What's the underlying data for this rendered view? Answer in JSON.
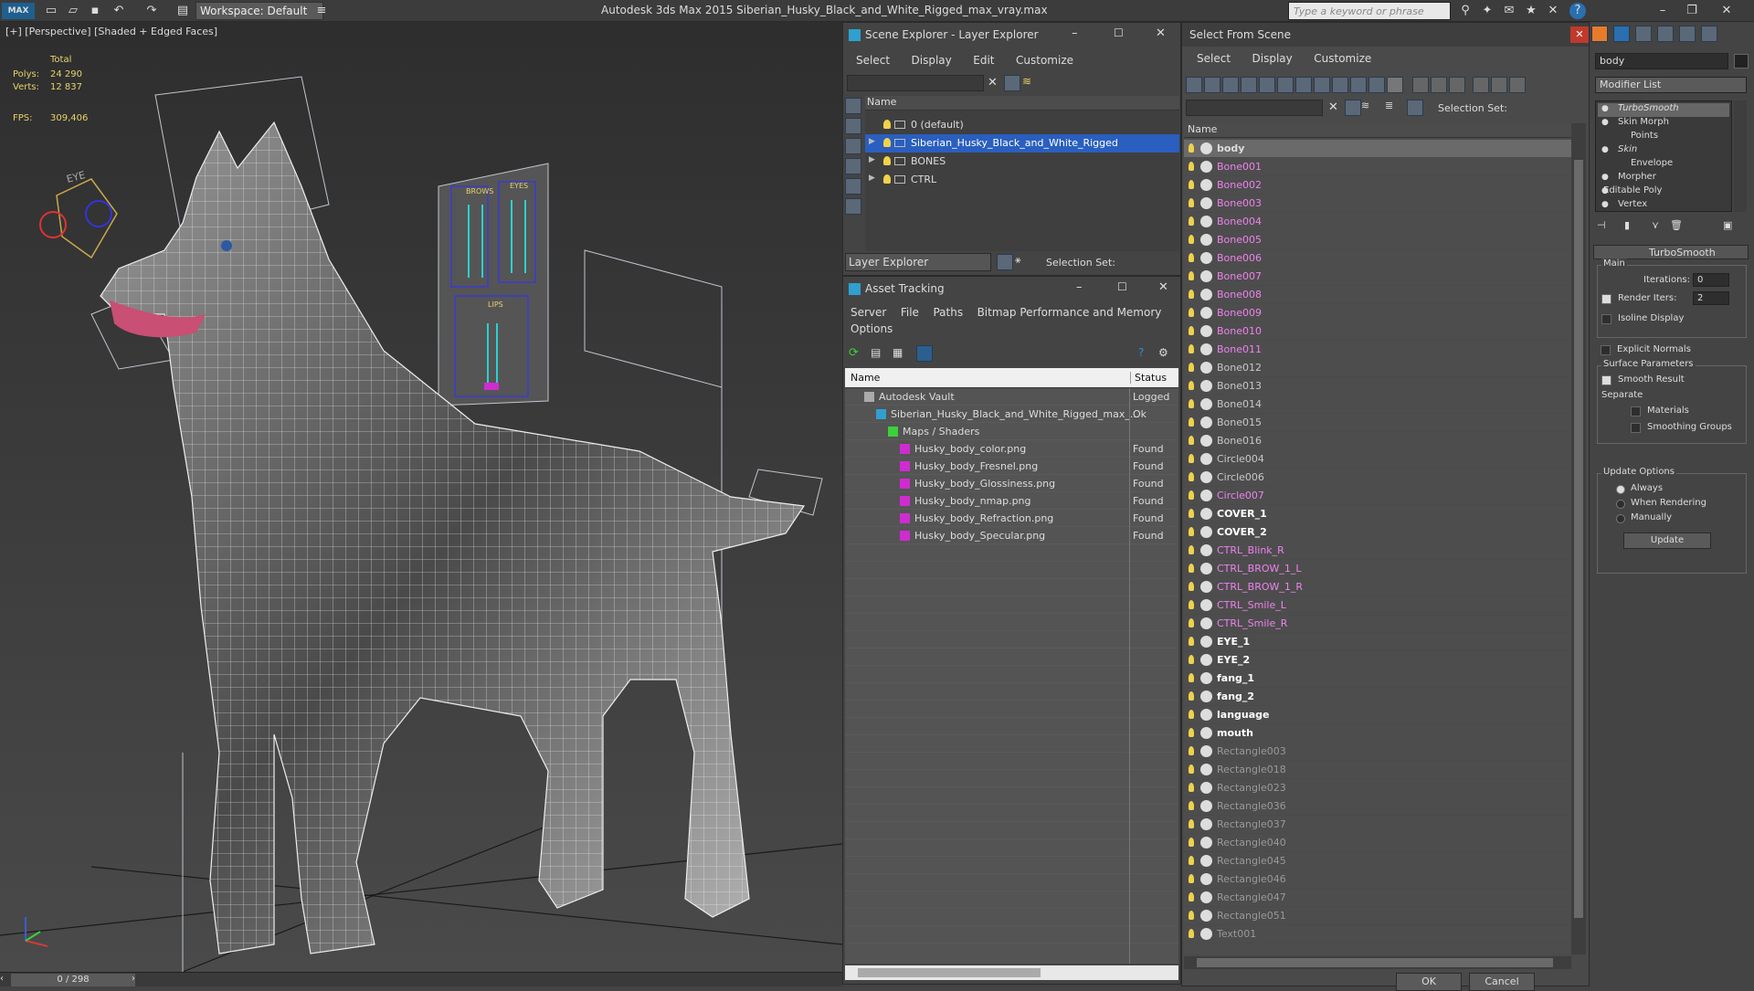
{
  "titlebar": {
    "workspace": "Workspace: Default",
    "title": "Autodesk 3ds Max  2015      Siberian_Husky_Black_and_White_Rigged_max_vray.max",
    "search_placeholder": "Type a keyword or phrase"
  },
  "viewport": {
    "label": "[+] [Perspective] [Shaded + Edged Faces]",
    "stats": {
      "total": "Total",
      "polys_label": "Polys:",
      "polys": "24 290",
      "verts_label": "Verts:",
      "verts": "12 837",
      "fps_label": "FPS:",
      "fps": "309,406"
    },
    "panel_labels": {
      "eye": "EYE",
      "brows": "BROWS",
      "eyes": "EYES",
      "lips": "LIPS"
    },
    "frame": "0 / 298"
  },
  "scene_explorer": {
    "title": "Scene Explorer - Layer Explorer",
    "menus": [
      "Select",
      "Display",
      "Edit",
      "Customize"
    ],
    "column": "Name",
    "layers": [
      {
        "name": "0 (default)",
        "selected": false,
        "expandable": false
      },
      {
        "name": "Siberian_Husky_Black_and_White_Rigged",
        "selected": true,
        "expandable": true
      },
      {
        "name": "BONES",
        "selected": false,
        "expandable": true
      },
      {
        "name": "CTRL",
        "selected": false,
        "expandable": true
      }
    ],
    "footer_dropdown": "Layer Explorer",
    "selection_set": "Selection Set:"
  },
  "asset_tracking": {
    "title": "Asset Tracking",
    "menus": [
      "Server",
      "File",
      "Paths",
      "Bitmap Performance and Memory"
    ],
    "menu2": "Options",
    "col_name": "Name",
    "col_status": "Status",
    "rows": [
      {
        "indent": 1,
        "name": "Autodesk Vault",
        "status": "Logged",
        "icon": "vault"
      },
      {
        "indent": 2,
        "name": "Siberian_Husky_Black_and_White_Rigged_max_...",
        "status": "Ok",
        "icon": "max-file"
      },
      {
        "indent": 3,
        "name": "Maps / Shaders",
        "status": "",
        "icon": "maps"
      },
      {
        "indent": 4,
        "name": "Husky_body_color.png",
        "status": "Found",
        "icon": "png"
      },
      {
        "indent": 4,
        "name": "Husky_body_Fresnel.png",
        "status": "Found",
        "icon": "png"
      },
      {
        "indent": 4,
        "name": "Husky_body_Glossiness.png",
        "status": "Found",
        "icon": "png"
      },
      {
        "indent": 4,
        "name": "Husky_body_nmap.png",
        "status": "Found",
        "icon": "png"
      },
      {
        "indent": 4,
        "name": "Husky_body_Refraction.png",
        "status": "Found",
        "icon": "png"
      },
      {
        "indent": 4,
        "name": "Husky_body_Specular.png",
        "status": "Found",
        "icon": "png"
      }
    ]
  },
  "select_from_scene": {
    "title": "Select From Scene",
    "menus": [
      "Select",
      "Display",
      "Customize"
    ],
    "selection_set": "Selection Set:",
    "column": "Name",
    "ok": "OK",
    "cancel": "Cancel",
    "items": [
      {
        "name": "body",
        "color": "#dddddd",
        "bold": true,
        "selected": true
      },
      {
        "name": "Bone001",
        "color": "#ee82ee"
      },
      {
        "name": "Bone002",
        "color": "#ee82ee"
      },
      {
        "name": "Bone003",
        "color": "#ee82ee"
      },
      {
        "name": "Bone004",
        "color": "#ee82ee"
      },
      {
        "name": "Bone005",
        "color": "#ee82ee"
      },
      {
        "name": "Bone006",
        "color": "#ee82ee"
      },
      {
        "name": "Bone007",
        "color": "#ee82ee"
      },
      {
        "name": "Bone008",
        "color": "#ee82ee"
      },
      {
        "name": "Bone009",
        "color": "#ee82ee"
      },
      {
        "name": "Bone010",
        "color": "#ee82ee"
      },
      {
        "name": "Bone011",
        "color": "#ee82ee"
      },
      {
        "name": "Bone012",
        "color": "#c8c8c8"
      },
      {
        "name": "Bone013",
        "color": "#c8c8c8"
      },
      {
        "name": "Bone014",
        "color": "#c8c8c8"
      },
      {
        "name": "Bone015",
        "color": "#c8c8c8"
      },
      {
        "name": "Bone016",
        "color": "#c8c8c8"
      },
      {
        "name": "Circle004",
        "color": "#c8c8c8"
      },
      {
        "name": "Circle006",
        "color": "#c8c8c8"
      },
      {
        "name": "Circle007",
        "color": "#ee82ee"
      },
      {
        "name": "COVER_1",
        "color": "#ffffff",
        "bold": true
      },
      {
        "name": "COVER_2",
        "color": "#ffffff",
        "bold": true
      },
      {
        "name": "CTRL_Blink_R",
        "color": "#ee82ee"
      },
      {
        "name": "CTRL_BROW_1_L",
        "color": "#ee82ee"
      },
      {
        "name": "CTRL_BROW_1_R",
        "color": "#ee82ee"
      },
      {
        "name": "CTRL_Smile_L",
        "color": "#ee82ee"
      },
      {
        "name": "CTRL_Smile_R",
        "color": "#ee82ee"
      },
      {
        "name": "EYE_1",
        "color": "#ffffff",
        "bold": true
      },
      {
        "name": "EYE_2",
        "color": "#ffffff",
        "bold": true
      },
      {
        "name": "fang_1",
        "color": "#ffffff",
        "bold": true
      },
      {
        "name": "fang_2",
        "color": "#ffffff",
        "bold": true
      },
      {
        "name": "language",
        "color": "#ffffff",
        "bold": true
      },
      {
        "name": "mouth",
        "color": "#ffffff",
        "bold": true
      },
      {
        "name": "Rectangle003",
        "color": "#999999"
      },
      {
        "name": "Rectangle018",
        "color": "#999999"
      },
      {
        "name": "Rectangle023",
        "color": "#999999"
      },
      {
        "name": "Rectangle036",
        "color": "#999999"
      },
      {
        "name": "Rectangle037",
        "color": "#999999"
      },
      {
        "name": "Rectangle040",
        "color": "#999999"
      },
      {
        "name": "Rectangle045",
        "color": "#999999"
      },
      {
        "name": "Rectangle046",
        "color": "#999999"
      },
      {
        "name": "Rectangle047",
        "color": "#999999"
      },
      {
        "name": "Rectangle051",
        "color": "#999999"
      },
      {
        "name": "Text001",
        "color": "#999999"
      }
    ]
  },
  "modify_panel": {
    "name_field": "body",
    "modifier_list": "Modifier List",
    "stack": [
      {
        "name": "TurboSmooth",
        "italic": true,
        "selected": true
      },
      {
        "name": "Skin Morph",
        "italic": false
      },
      {
        "name": "Points",
        "italic": false
      },
      {
        "name": "Skin",
        "italic": true
      },
      {
        "name": "Envelope",
        "italic": false
      },
      {
        "name": "Morpher",
        "italic": false
      },
      {
        "name": "Editable Poly",
        "italic": false
      },
      {
        "name": "Vertex",
        "italic": false
      }
    ],
    "rollout_title": "TurboSmooth",
    "main_label": "Main",
    "iterations_label": "Iterations:",
    "iterations": "0",
    "render_iters_label": "Render Iters:",
    "render_iters": "2",
    "isoline": "Isoline Display",
    "explicit_normals": "Explicit Normals",
    "surface_params": "Surface Parameters",
    "smooth_result": "Smooth Result",
    "separate": "Separate",
    "materials": "Materials",
    "smoothing_groups": "Smoothing Groups",
    "update_options": "Update Options",
    "always": "Always",
    "when_rendering": "When Rendering",
    "manually": "Manually",
    "update_btn": "Update"
  }
}
